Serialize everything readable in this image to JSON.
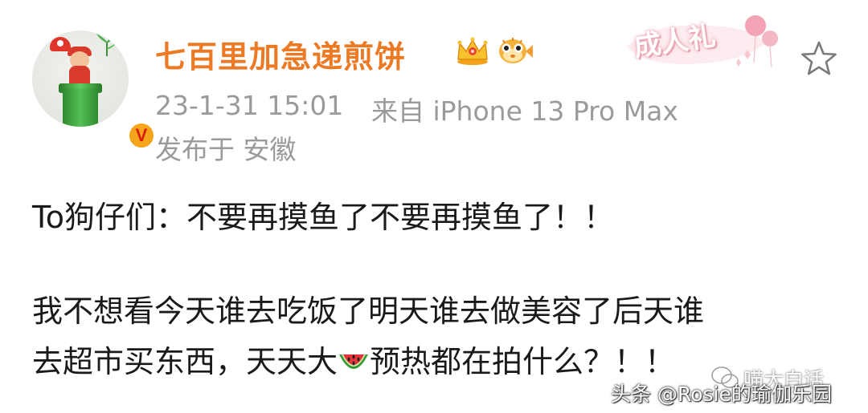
{
  "post": {
    "author": {
      "name": "七百里加急递煎饼",
      "verified_badge": "V",
      "badges": [
        "crown-icon",
        "pufferfish-icon"
      ]
    },
    "meta": {
      "time": "23-1-31 15:01",
      "source": "来自 iPhone 13 Pro Max",
      "location": "发布于 安徽"
    },
    "decoration": {
      "label": "成人礼"
    },
    "content": {
      "line1": "To狗仔们：不要再摸鱼了不要再摸鱼了！！",
      "line2": "我不想看今天谁去吃饭了明天谁去做美容了后天谁",
      "line3_before": "去超市买东西，天天大",
      "line3_emoji": "watermelon-icon",
      "line3_after": "预热都在拍什么？！！"
    }
  },
  "watermarks": {
    "wechat": "喵大白话",
    "toutiao": "头条 @Rosie的瑜伽乐园"
  },
  "colors": {
    "username": "#ec7a24",
    "meta": "#9a9a9a",
    "text": "#1a1a1a",
    "verified": "#f5a51c"
  }
}
